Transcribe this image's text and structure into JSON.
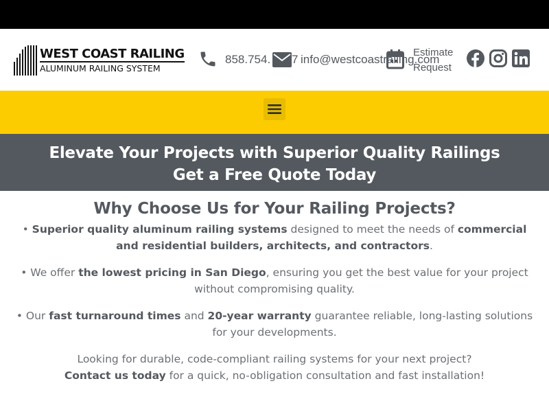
{
  "brand": {
    "title": "WEST COAST RAILING",
    "subtitle": "ALUMINUM RAILING SYSTEM"
  },
  "header": {
    "phone": "858.754.",
    "phone_tail": "7",
    "email": "info@westcoastrailing.com",
    "estimate_line1": "Estimate",
    "estimate_line2": "Request",
    "icons": {
      "phone": "phone-icon",
      "email": "envelope-icon",
      "estimate": "calendar-icon",
      "facebook": "facebook-icon",
      "instagram": "instagram-icon",
      "linkedin": "linkedin-icon"
    }
  },
  "nav": {
    "menu_icon": "hamburger-menu-icon"
  },
  "banner": {
    "line1": "Elevate Your Projects with Superior Quality Railings",
    "line2": "Get a Free Quote Today"
  },
  "content": {
    "heading": "Why Choose Us for Your Railing Projects?",
    "p1": {
      "bullet": "• ",
      "b1": "Superior quality aluminum railing systems",
      "t1": " designed to meet the needs of ",
      "b2": "commercial and residential builders, architects, and contractors",
      "t2": "."
    },
    "p2": {
      "bullet": "• We offer ",
      "b1": "the lowest pricing in San Diego",
      "t1": ", ensuring you get the best value for your project without compromising quality."
    },
    "p3": {
      "bullet": "• ",
      "t0": "Our ",
      "b1": "fast turnaround times",
      "t1": " and ",
      "b2": "20-year warranty",
      "t2": " guarantee reliable, long-lasting solutions for your developments."
    },
    "p4": {
      "line1": "Looking for durable, code-compliant railing systems for your next project?",
      "b1": "Contact us today",
      "t1": " for a quick, no-obligation consultation and fast installation!"
    }
  },
  "colors": {
    "top_strip": "#000000",
    "nav_bg": "#fccc00",
    "banner_bg": "#54595f",
    "text": "#54595f"
  }
}
